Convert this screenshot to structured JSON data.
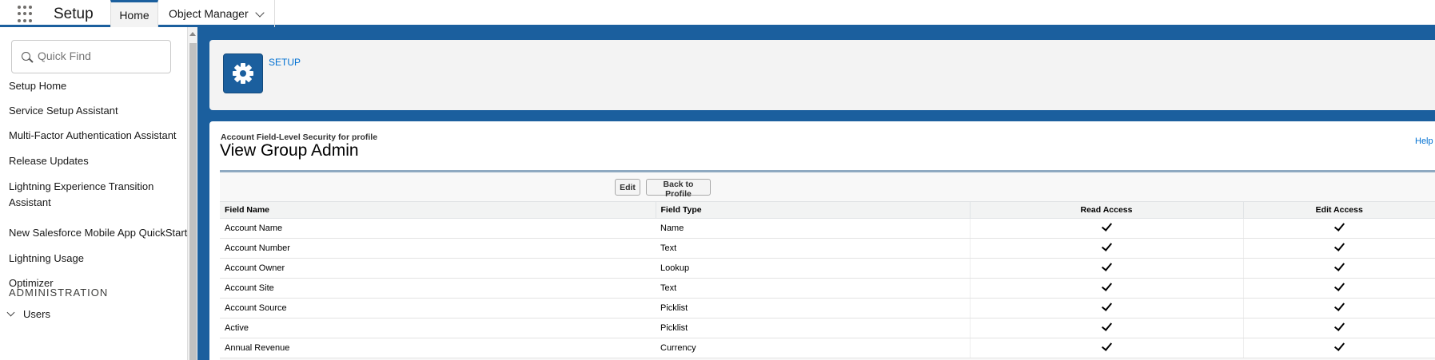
{
  "header": {
    "app_title": "Setup",
    "tabs": [
      {
        "label": "Home"
      },
      {
        "label": "Object Manager"
      }
    ]
  },
  "sidebar": {
    "search": {
      "placeholder": "Quick Find"
    },
    "items": [
      {
        "label": "Setup Home"
      },
      {
        "label": "Service Setup Assistant"
      },
      {
        "label": "Multi-Factor Authentication Assistant"
      },
      {
        "label": "Release Updates"
      },
      {
        "label": "Lightning Experience Transition Assistant"
      },
      {
        "label": "New Salesforce Mobile App QuickStart"
      },
      {
        "label": "Lightning Usage"
      },
      {
        "label": "Optimizer"
      }
    ],
    "section_header": "ADMINISTRATION",
    "users_label": "Users"
  },
  "breadcrumb": {
    "setup_label": "SETUP"
  },
  "page": {
    "subtitle": "Account Field-Level Security for profile",
    "title": "View Group Admin",
    "help_link": "Help"
  },
  "buttons": {
    "edit": "Edit",
    "back": "Back to Profile"
  },
  "table": {
    "headers": {
      "field_name": "Field Name",
      "field_type": "Field Type",
      "read": "Read Access",
      "edit": "Edit Access"
    },
    "rows": [
      {
        "name": "Account Name",
        "type": "Name",
        "read": true,
        "edit": true
      },
      {
        "name": "Account Number",
        "type": "Text",
        "read": true,
        "edit": true
      },
      {
        "name": "Account Owner",
        "type": "Lookup",
        "read": true,
        "edit": true
      },
      {
        "name": "Account Site",
        "type": "Text",
        "read": true,
        "edit": true
      },
      {
        "name": "Account Source",
        "type": "Picklist",
        "read": true,
        "edit": true
      },
      {
        "name": "Active",
        "type": "Picklist",
        "read": true,
        "edit": true
      },
      {
        "name": "Annual Revenue",
        "type": "Currency",
        "read": true,
        "edit": true
      }
    ]
  },
  "colors": {
    "brand": "#1b5f9e",
    "link": "#0070d2"
  },
  "icons": [
    "app-launcher-icon",
    "chevron-down-icon",
    "search-icon",
    "gear-icon",
    "checkmark-icon"
  ]
}
